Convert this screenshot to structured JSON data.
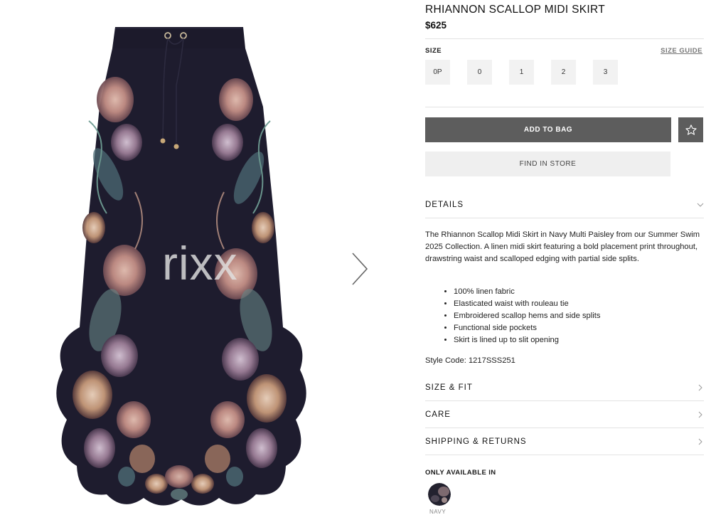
{
  "product": {
    "title": "RHIANNON SCALLOP MIDI SKIRT",
    "price": "$625"
  },
  "gallery": {
    "watermark": "rixx",
    "image_icon": "paisley-skirt-image",
    "next_icon": "chevron-right-icon"
  },
  "size": {
    "label": "SIZE",
    "guide_label": "SIZE GUIDE",
    "options": [
      "0P",
      "0",
      "1",
      "2",
      "3"
    ]
  },
  "actions": {
    "add_to_bag": "ADD TO BAG",
    "wishlist_icon": "star-icon",
    "find_in_store": "FIND IN STORE"
  },
  "details": {
    "heading": "DETAILS",
    "description": "The Rhiannon Scallop Midi Skirt in Navy Multi Paisley from our Summer Swim 2025 Collection. A linen midi skirt featuring a bold placement print throughout, drawstring waist and scalloped edging with partial side splits.",
    "bullets": [
      "100% linen fabric",
      "Elasticated waist with rouleau tie",
      "Embroidered scallop hems and side splits",
      "Functional side pockets",
      "Skirt is lined up to slit opening"
    ],
    "style_code": "Style Code: 1217SSS251"
  },
  "sections": {
    "size_fit": "SIZE & FIT",
    "care": "CARE",
    "shipping": "SHIPPING & RETURNS"
  },
  "availability": {
    "label": "ONLY AVAILABLE IN",
    "swatch_label": "NAVY"
  },
  "colors": {
    "skirt_navy": "#1e1c2e",
    "button_dark": "#5d5d5d",
    "button_light": "#efefef"
  }
}
